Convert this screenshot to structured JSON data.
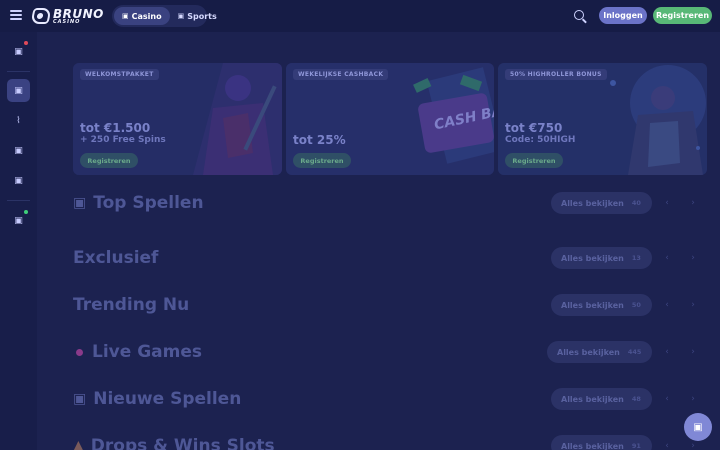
{
  "header": {
    "logo_name": "BRUNO",
    "logo_sub": "CASINO",
    "modes": [
      {
        "label": "Casino",
        "icon": "▣"
      },
      {
        "label": "Sports",
        "icon": "▣"
      }
    ],
    "login_label": "Inloggen",
    "register_label": "Registreren"
  },
  "sidebar": {
    "items": [
      {
        "icon": "▣",
        "name": "sidebar-item-1"
      },
      {
        "icon": "▣",
        "name": "sidebar-item-2"
      },
      {
        "icon": "⌇",
        "name": "sidebar-item-3"
      },
      {
        "icon": "▣",
        "name": "sidebar-item-4"
      },
      {
        "icon": "▣",
        "name": "sidebar-item-5"
      },
      {
        "icon": "▣",
        "name": "sidebar-item-6"
      }
    ]
  },
  "banners": [
    {
      "tag": "WELKOMSTPAKKET",
      "line1": "tot €1.500",
      "line2": "+ 250 Free Spins",
      "cta": "Registreren"
    },
    {
      "tag": "WEKELIJKSE CASHBACK",
      "line1": "tot 25%",
      "line2": "",
      "cta": "Registreren"
    },
    {
      "tag": "50% HIGHROLLER BONUS",
      "line1": "tot €750",
      "line2": "Code: 50HIGH",
      "cta": "Registreren"
    }
  ],
  "banner_art_text": "CASH BACK",
  "sections": [
    {
      "title": "Top Spellen",
      "icon": "▣",
      "see_all": "Alles bekijken",
      "count": "40"
    },
    {
      "title": "Exclusief",
      "icon": "",
      "see_all": "Alles bekijken",
      "count": "13"
    },
    {
      "title": "Trending Nu",
      "icon": "",
      "see_all": "Alles bekijken",
      "count": "50"
    },
    {
      "title": "Live Games",
      "icon": "",
      "see_all": "Alles bekijken",
      "count": "445"
    },
    {
      "title": "Nieuwe Spellen",
      "icon": "▣",
      "see_all": "Alles bekijken",
      "count": "48"
    },
    {
      "title": "Drops & Wins Slots",
      "icon": "▲",
      "see_all": "Alles bekijken",
      "count": "91"
    }
  ],
  "arrows": {
    "prev": "‹",
    "next": "›"
  },
  "fab_icon": "▣",
  "colors": {
    "background": "#1c2250",
    "login": "#6b73c8",
    "register": "#58b877",
    "notification_red": "#e04a5a",
    "notification_green": "#3fcf7a"
  }
}
